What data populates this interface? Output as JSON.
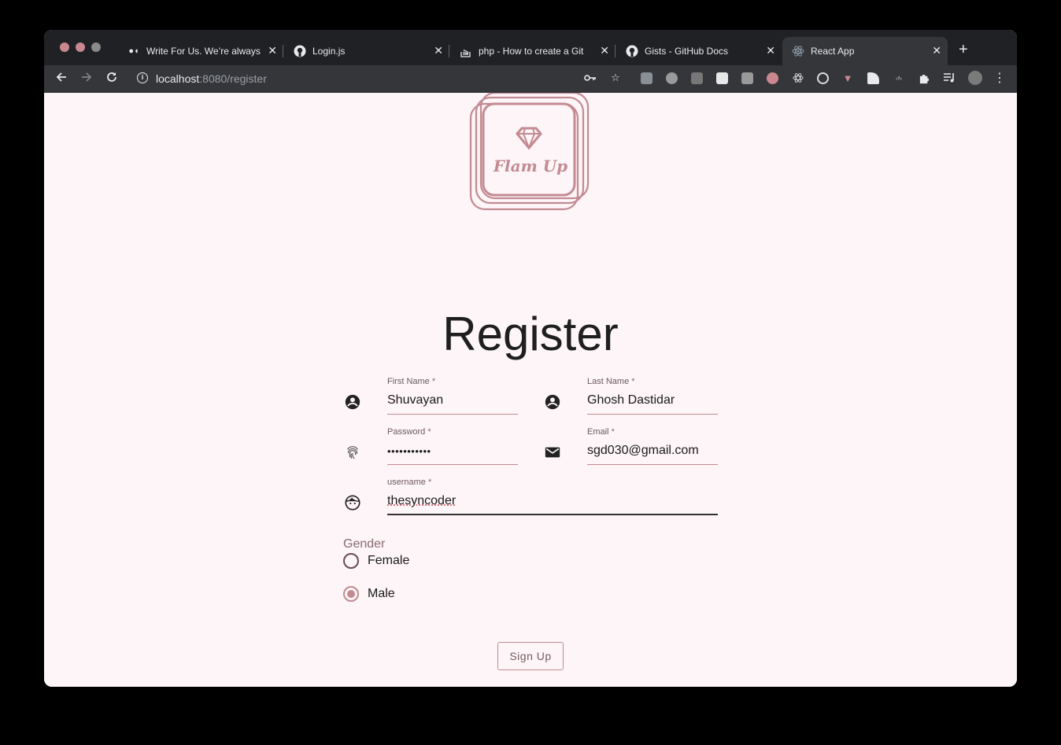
{
  "browser": {
    "tabs": [
      {
        "label": "Write For Us. We’re always",
        "icon": "medium-icon"
      },
      {
        "label": "Login.js",
        "icon": "github-icon"
      },
      {
        "label": "php - How to create a Git",
        "icon": "stackoverflow-icon"
      },
      {
        "label": "Gists - GitHub Docs",
        "icon": "github-icon"
      },
      {
        "label": "React App",
        "icon": "react-icon",
        "active": true
      }
    ],
    "url_host": "localhost",
    "url_path": ":8080/register"
  },
  "logo": {
    "text": "Flam Up",
    "icon": "diamond-icon",
    "color": "#c38a92"
  },
  "form": {
    "title": "Register",
    "first_name": {
      "label": "First Name",
      "required": "*",
      "value": "Shuvayan",
      "icon": "account-circle-icon"
    },
    "last_name": {
      "label": "Last Name",
      "required": "*",
      "value": "Ghosh Dastidar",
      "icon": "account-circle-icon"
    },
    "password": {
      "label": "Password",
      "required": "*",
      "value": "•••••••••••",
      "icon": "fingerprint-icon"
    },
    "email": {
      "label": "Email",
      "required": "*",
      "value": "sgd030@gmail.com",
      "icon": "mail-icon"
    },
    "username": {
      "label": "username",
      "required": "*",
      "value": "thesyncoder",
      "icon": "face-icon"
    },
    "gender": {
      "label": "Gender",
      "options": [
        {
          "label": "Female",
          "checked": false
        },
        {
          "label": "Male",
          "checked": true
        }
      ]
    },
    "submit_label": "Sign Up"
  },
  "colors": {
    "accent": "#c38a92",
    "page_bg": "#fdf5f8",
    "titlebar": "#202124",
    "toolbar": "#35363a"
  }
}
